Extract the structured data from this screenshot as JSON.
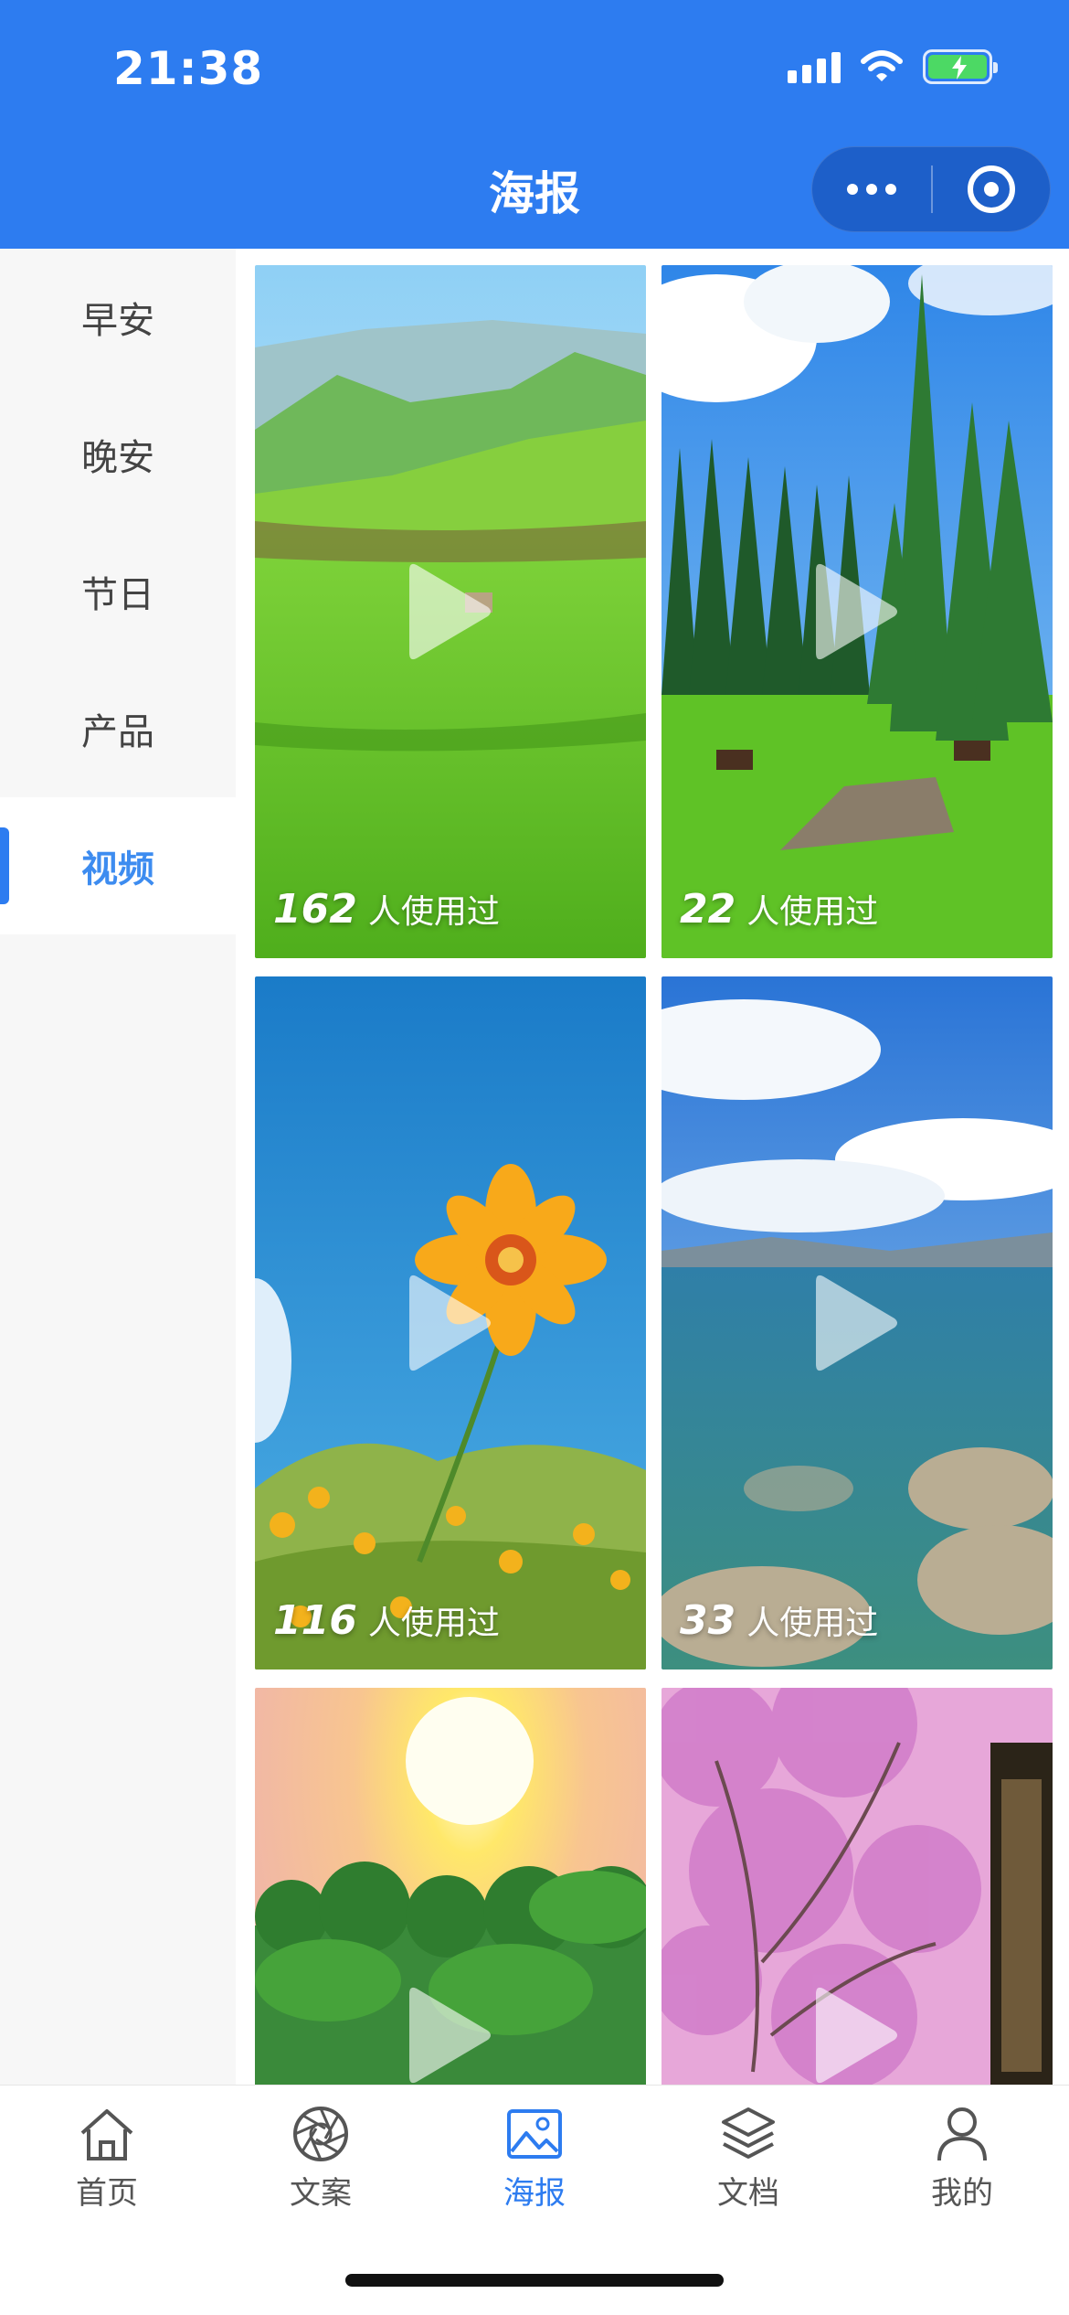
{
  "status_bar": {
    "time": "21:38"
  },
  "header": {
    "title": "海报"
  },
  "sidebar": {
    "items": [
      {
        "label": "早安",
        "active": false
      },
      {
        "label": "晚安",
        "active": false
      },
      {
        "label": "节日",
        "active": false
      },
      {
        "label": "产品",
        "active": false
      },
      {
        "label": "视频",
        "active": true
      }
    ]
  },
  "grid": {
    "cards": [
      {
        "scene": "grassland-mountains",
        "count": "162",
        "label": "人使用过"
      },
      {
        "scene": "pine-forest-horses",
        "count": "22",
        "label": "人使用过"
      },
      {
        "scene": "yellow-flower-sky",
        "count": "116",
        "label": "人使用过"
      },
      {
        "scene": "lake-rocks-clouds",
        "count": "33",
        "label": "人使用过"
      },
      {
        "scene": "sunset-lotus",
        "count": "",
        "label": ""
      },
      {
        "scene": "pink-blossoms",
        "count": "",
        "label": ""
      }
    ]
  },
  "tabbar": {
    "items": [
      {
        "label": "首页",
        "icon": "home-icon",
        "active": false
      },
      {
        "label": "文案",
        "icon": "aperture-icon",
        "active": false
      },
      {
        "label": "海报",
        "icon": "image-icon",
        "active": true
      },
      {
        "label": "文档",
        "icon": "layers-icon",
        "active": false
      },
      {
        "label": "我的",
        "icon": "user-icon",
        "active": false
      }
    ]
  },
  "colors": {
    "primary": "#2d7cf0",
    "active_text": "#3d8cf0"
  }
}
